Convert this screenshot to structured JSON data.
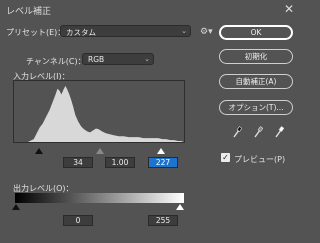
{
  "window": {
    "title": "レベル補正",
    "close_glyph": "✕"
  },
  "preset": {
    "label": "プリセット(E)：",
    "value": "カスタム"
  },
  "channel": {
    "label": "チャンネル(C)：",
    "value": "RGB"
  },
  "input_levels": {
    "label": "入力レベル(I)：",
    "shadow": "34",
    "midtone": "1.00",
    "highlight": "227"
  },
  "output_levels": {
    "label": "出力レベル(O)：",
    "low": "0",
    "high": "255"
  },
  "buttons": {
    "ok": "OK",
    "reset": "初期化",
    "auto": "自動補正(A)",
    "options": "オプション(T)..."
  },
  "preview": {
    "label": "プレビュー(P)",
    "checked": true
  },
  "colors": {
    "dialog_bg": "#535353",
    "field_bg": "#3d3d3d",
    "highlight_field": "#1c74ce",
    "histogram": "#d6d6d6"
  }
}
